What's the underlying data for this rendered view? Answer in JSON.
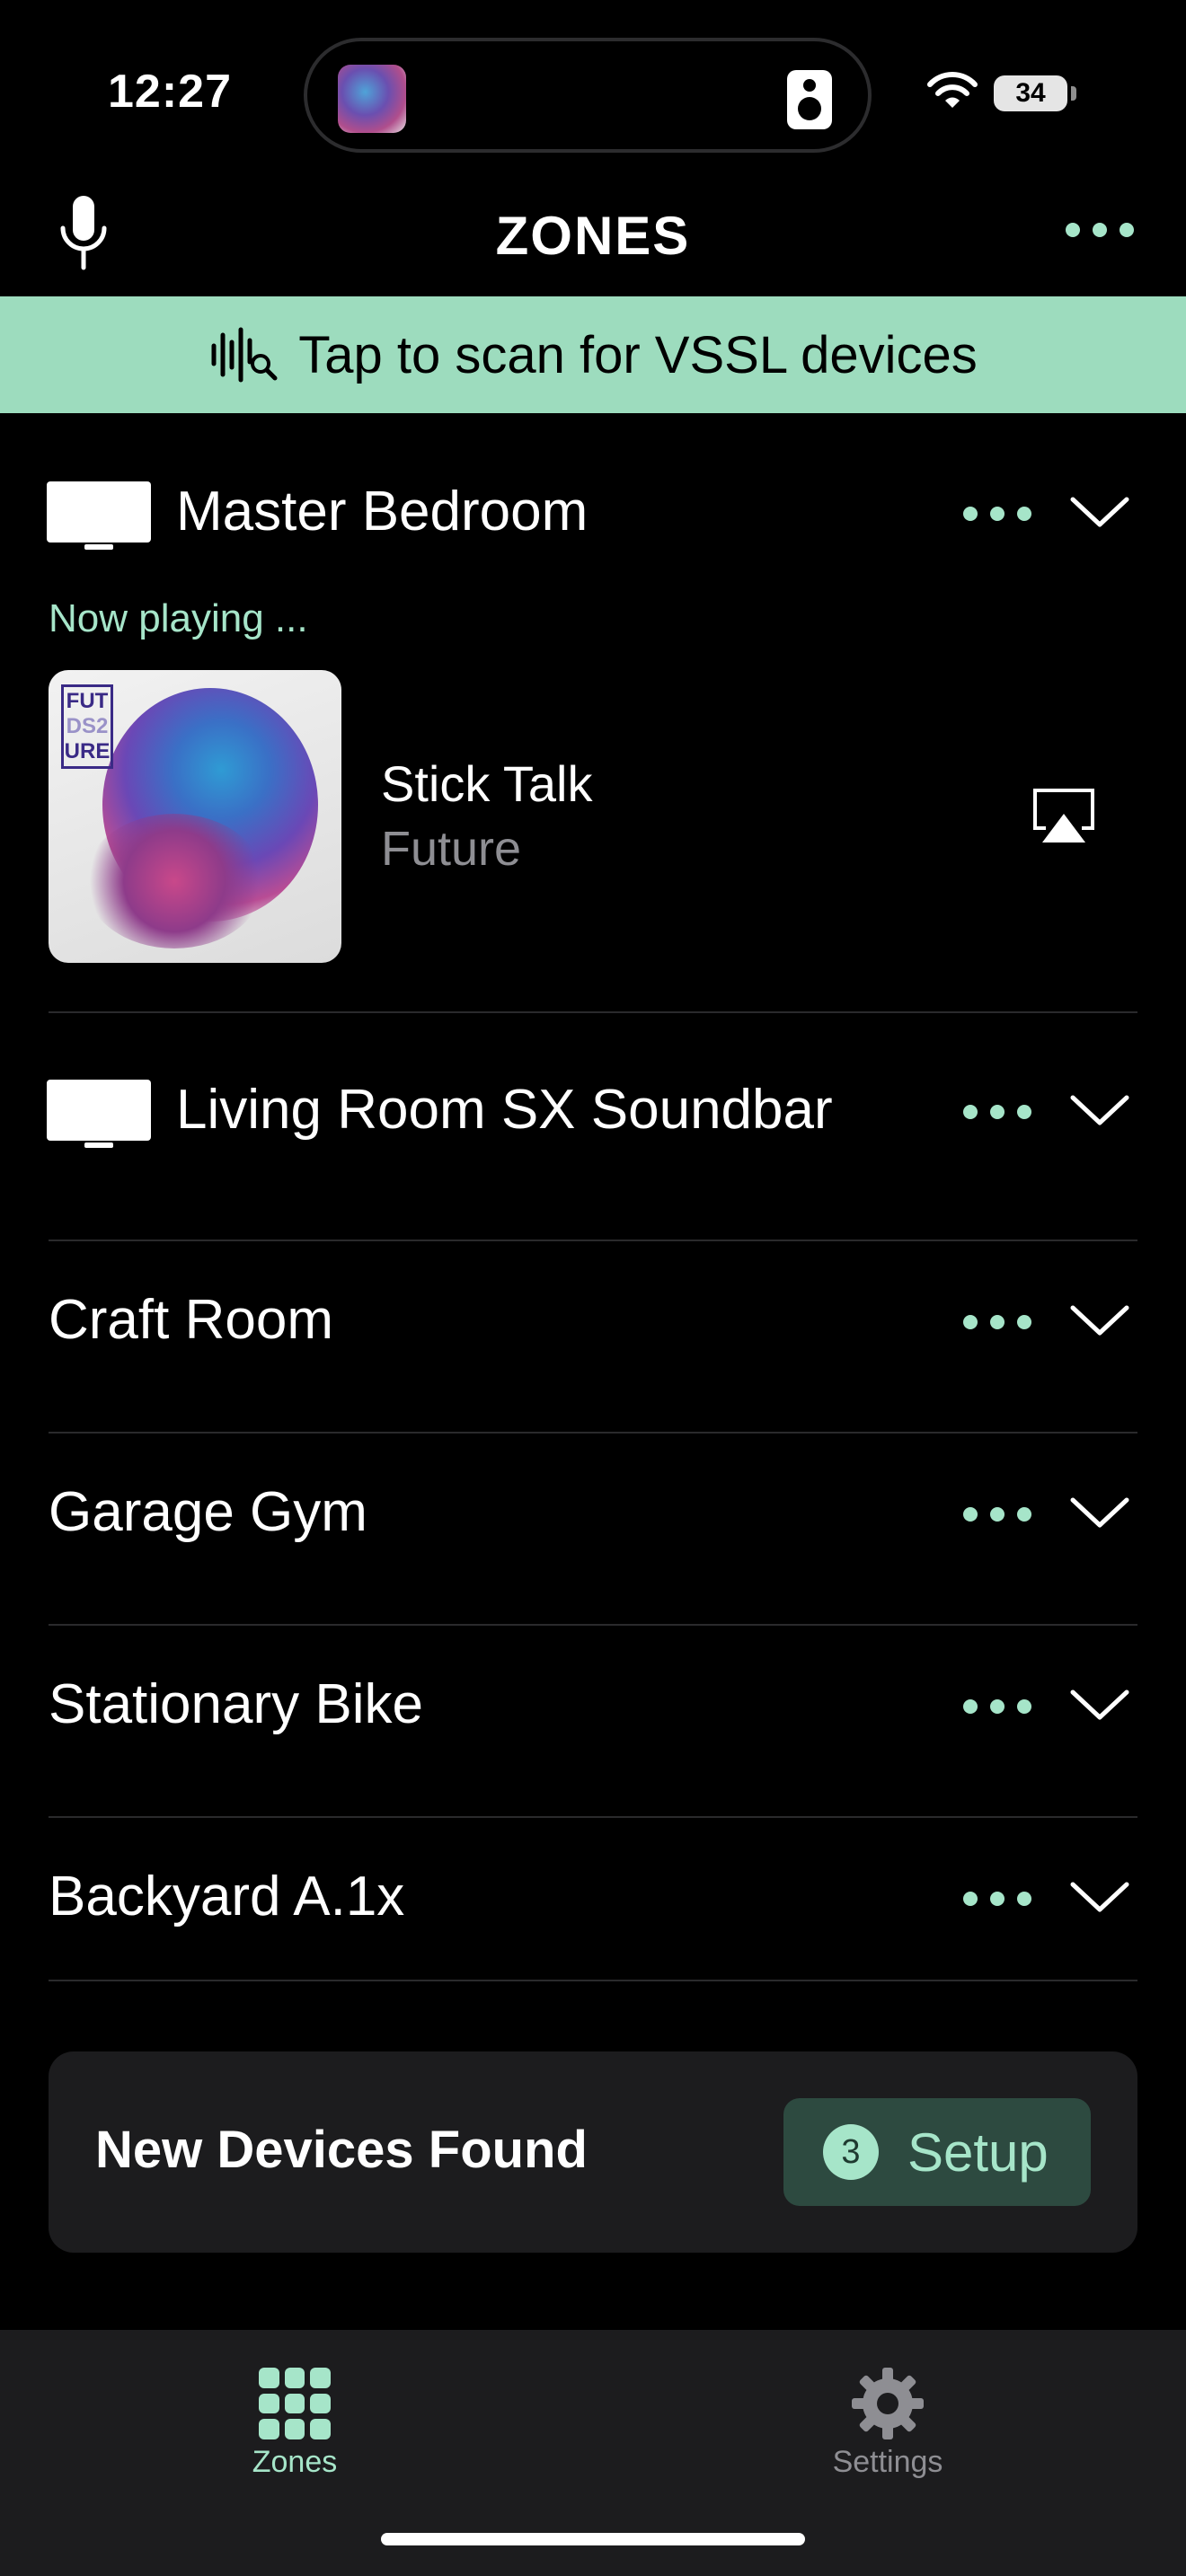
{
  "status_bar": {
    "time": "12:27",
    "battery": "34"
  },
  "header": {
    "title": "ZONES"
  },
  "scan_banner": {
    "text": "Tap to scan for VSSL devices"
  },
  "zones": [
    {
      "name": "Master Bedroom",
      "has_tv_icon": true,
      "now_playing": {
        "label": "Now playing ...",
        "title": "Stick Talk",
        "artist": "Future",
        "album_logo_lines": [
          "FUT",
          "DS2",
          "URE"
        ]
      }
    },
    {
      "name": "Living Room SX Soundbar",
      "has_tv_icon": true
    },
    {
      "name": "Craft Room",
      "has_tv_icon": false
    },
    {
      "name": "Garage Gym",
      "has_tv_icon": false
    },
    {
      "name": "Stationary Bike",
      "has_tv_icon": false
    },
    {
      "name": "Backyard A.1x",
      "has_tv_icon": false
    }
  ],
  "new_devices": {
    "title": "New Devices Found",
    "count": "3",
    "button_label": "Setup"
  },
  "tab_bar": {
    "tabs": [
      {
        "label": "Zones",
        "icon": "grid-icon",
        "active": true,
        "color": "#a6e5c9"
      },
      {
        "label": "Settings",
        "icon": "gear-icon",
        "active": false,
        "color": "#8e8e93"
      }
    ]
  },
  "colors": {
    "accent": "#a6e5c9",
    "banner": "#9ddcbe",
    "background": "#000000",
    "card": "#1c1c1e"
  }
}
